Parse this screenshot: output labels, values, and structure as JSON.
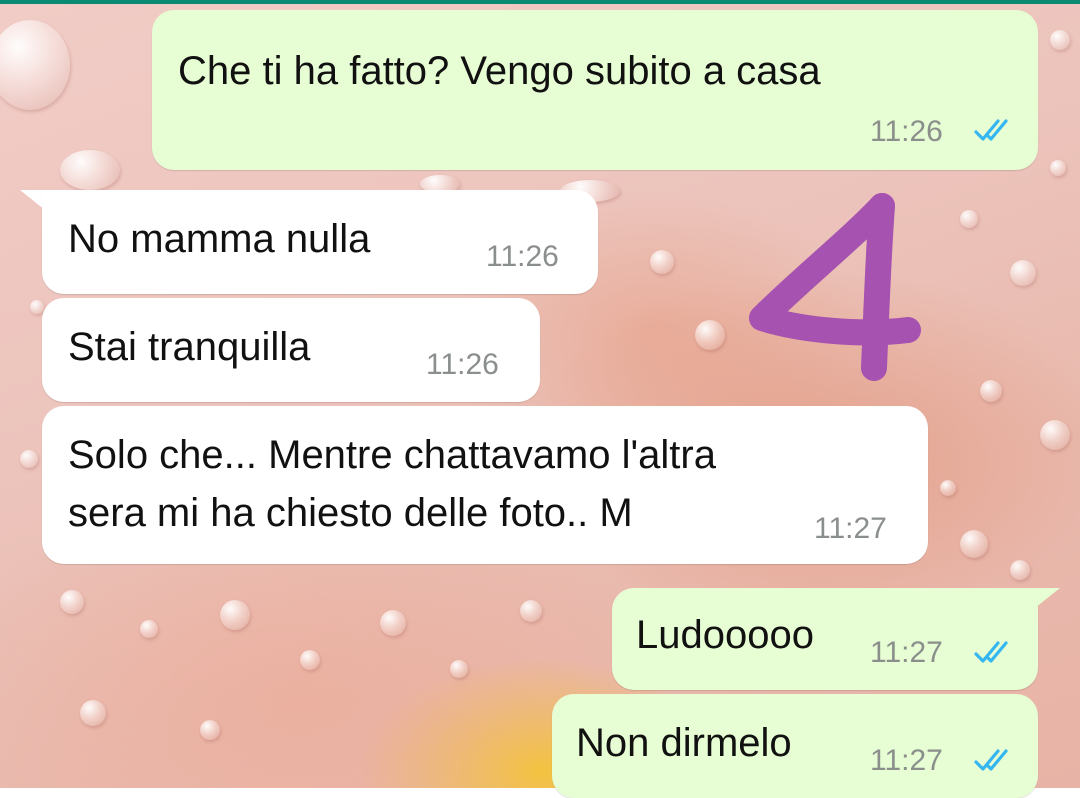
{
  "colors": {
    "outgoing_bubble": "#e7fdd3",
    "incoming_bubble": "#ffffff",
    "read_ticks": "#34b7f1",
    "timestamp": "#8a8f8c",
    "sticker": "#a652b0"
  },
  "messages": [
    {
      "direction": "outgoing",
      "text": "Che ti ha fatto? Vengo subito a casa",
      "time": "11:26",
      "status": "read"
    },
    {
      "direction": "incoming",
      "text": "No mamma nulla",
      "time": "11:26"
    },
    {
      "direction": "incoming",
      "text": "Stai tranquilla",
      "time": "11:26"
    },
    {
      "direction": "incoming",
      "lines": [
        "Solo che... Mentre chattavamo l'altra",
        "sera mi ha chiesto delle foto.. M"
      ],
      "time": "11:27"
    },
    {
      "direction": "outgoing",
      "text": "Ludooooo",
      "time": "11:27",
      "status": "read"
    },
    {
      "direction": "outgoing",
      "text": "Non dirmelo",
      "time": "11:27",
      "status": "read"
    }
  ],
  "overlay": {
    "sticker_text": "4",
    "icon": "number-four-sticker"
  }
}
